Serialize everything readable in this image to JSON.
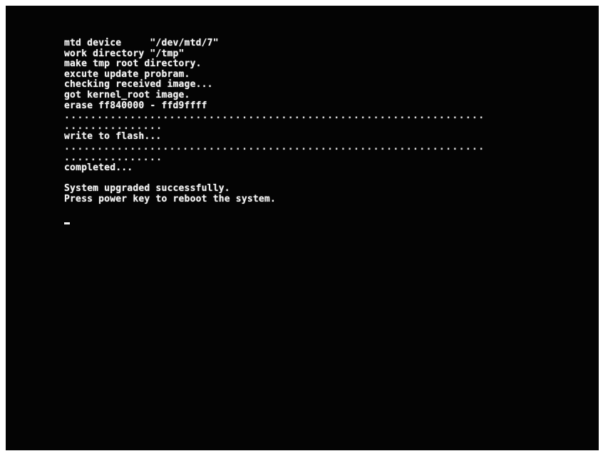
{
  "console": {
    "lines": [
      "mtd device     \"/dev/mtd/7\"",
      "work directory \"/tmp\"",
      "make tmp root directory.",
      "excute update probram.",
      "checking received image...",
      "got kernel_root image.",
      "erase ff840000 - ffd9ffff",
      "................................................................",
      "...............",
      "write to flash...",
      "................................................................",
      "...............",
      "completed...",
      "System upgraded successfully.",
      "Press power key to reboot the system."
    ],
    "cursor": "_"
  }
}
